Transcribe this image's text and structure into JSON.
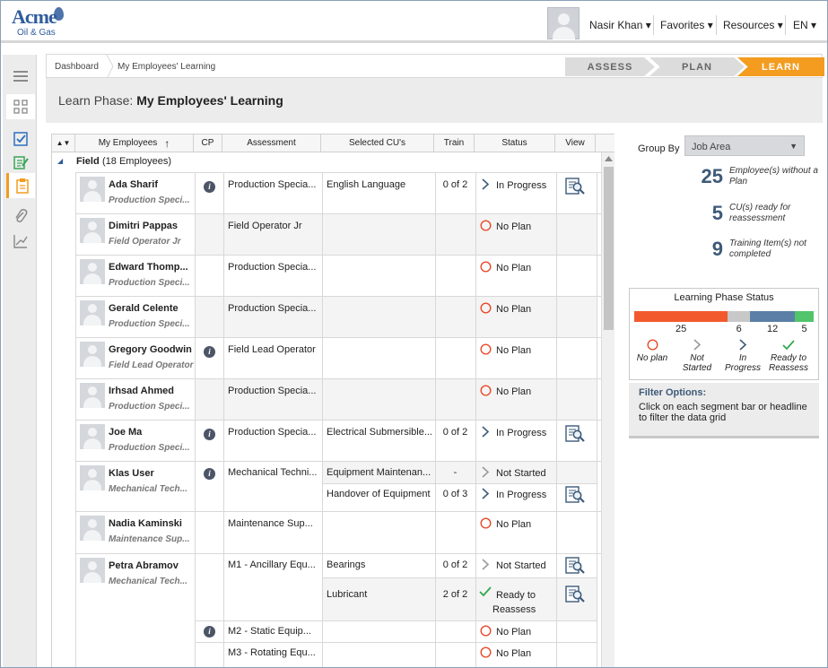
{
  "header": {
    "logo": {
      "brand": "Acme",
      "sub": "Oil & Gas"
    },
    "user": "Nasir Khan",
    "menus": [
      "Favorites",
      "Resources",
      "EN"
    ]
  },
  "breadcrumb": [
    "Dashboard",
    "My Employees' Learning"
  ],
  "phases": [
    "ASSESS",
    "PLAN",
    "LEARN"
  ],
  "title": {
    "prefix": "Learn Phase:",
    "name": "My Employees' Learning"
  },
  "grid": {
    "columns": [
      "My Employees",
      "CP",
      "Assessment",
      "Selected CU's",
      "Train",
      "Status",
      "View"
    ],
    "sort_arrow": "↑",
    "group": {
      "name": "Field",
      "count": "(18 Employees)"
    },
    "employees": [
      {
        "name": "Ada Sharif",
        "job": "Production Speci...",
        "info": true,
        "assess": "Production Specia...",
        "cu": "English Language",
        "train": "0 of 2",
        "status": "In Progress",
        "view": true
      },
      {
        "name": "Dimitri Pappas",
        "job": "Field Operator Jr",
        "info": false,
        "assess": "Field Operator Jr",
        "cu": "",
        "train": "",
        "status": "No Plan",
        "view": false
      },
      {
        "name": "Edward Thomp...",
        "job": "Production Speci...",
        "info": false,
        "assess": "Production Specia...",
        "cu": "",
        "train": "",
        "status": "No Plan",
        "view": false
      },
      {
        "name": "Gerald Celente",
        "job": "Production Speci...",
        "info": false,
        "assess": "Production Specia...",
        "cu": "",
        "train": "",
        "status": "No Plan",
        "view": false
      },
      {
        "name": "Gregory Goodwin",
        "job": "Field Lead Operator",
        "info": true,
        "assess": "Field Lead Operator",
        "cu": "",
        "train": "",
        "status": "No Plan",
        "view": false
      },
      {
        "name": "Irhsad Ahmed",
        "job": "Production Speci...",
        "info": false,
        "assess": "Production Specia...",
        "cu": "",
        "train": "",
        "status": "No Plan",
        "view": false
      },
      {
        "name": "Joe Ma",
        "job": "Production Speci...",
        "info": true,
        "assess": "Production Specia...",
        "cu": "Electrical Submersible...",
        "train": "0 of 2",
        "status": "In Progress",
        "view": true
      }
    ],
    "klas": {
      "name": "Klas User",
      "job": "Mechanical Tech...",
      "assess": "Mechanical Techni...",
      "items": [
        {
          "cu": "Equipment Maintenan...",
          "train": "-",
          "status": "Not Started"
        },
        {
          "cu": "Handover of Equipment",
          "train": "0 of 3",
          "status": "In Progress"
        }
      ]
    },
    "nadia": {
      "name": "Nadia Kaminski",
      "job": "Maintenance Sup...",
      "assess": "Maintenance Sup...",
      "status": "No Plan"
    },
    "petra": {
      "name": "Petra Abramov",
      "job": "Mechanical Tech...",
      "a1": "M1 - Ancillary Equ...",
      "items": [
        {
          "cu": "Bearings",
          "train": "0 of 2",
          "status": "Not Started"
        },
        {
          "cu": "Lubricant",
          "train": "2 of 2",
          "status_l1": "Ready to",
          "status_l2": "Reassess"
        }
      ],
      "a2": "M2 - Static Equip...",
      "a2_status": "No Plan",
      "a3": "M3 - Rotating Equ...",
      "a3_status": "No Plan"
    }
  },
  "sidepanel": {
    "group_by_label": "Group By",
    "group_by_value": "Job Area",
    "kpis": [
      {
        "n": "25",
        "l1": "Employee(s) without a",
        "l2": "Plan"
      },
      {
        "n": "5",
        "l1": "CU(s) ready for",
        "l2": "reassessment"
      },
      {
        "n": "9",
        "l1": "Training Item(s) not",
        "l2": "completed"
      }
    ],
    "status": {
      "title": "Learning Phase Status",
      "segments": [
        {
          "label": "No plan",
          "value": 25,
          "color": "#f25a2e"
        },
        {
          "label": "Not Started",
          "value": 6,
          "color": "#c8c8c8"
        },
        {
          "label": "In Progress",
          "value": 12,
          "color": "#5b7fa6"
        },
        {
          "label": "Ready to Reassess",
          "value": 5,
          "color": "#52c46b"
        }
      ],
      "legend": [
        {
          "l1": "No plan",
          "l2": ""
        },
        {
          "l1": "Not",
          "l2": "Started"
        },
        {
          "l1": "In",
          "l2": "Progress"
        },
        {
          "l1": "Ready to",
          "l2": "Reassess"
        }
      ]
    },
    "filter": {
      "title": "Filter Options:",
      "desc": "Click on each segment bar or headline to filter the data grid"
    }
  }
}
